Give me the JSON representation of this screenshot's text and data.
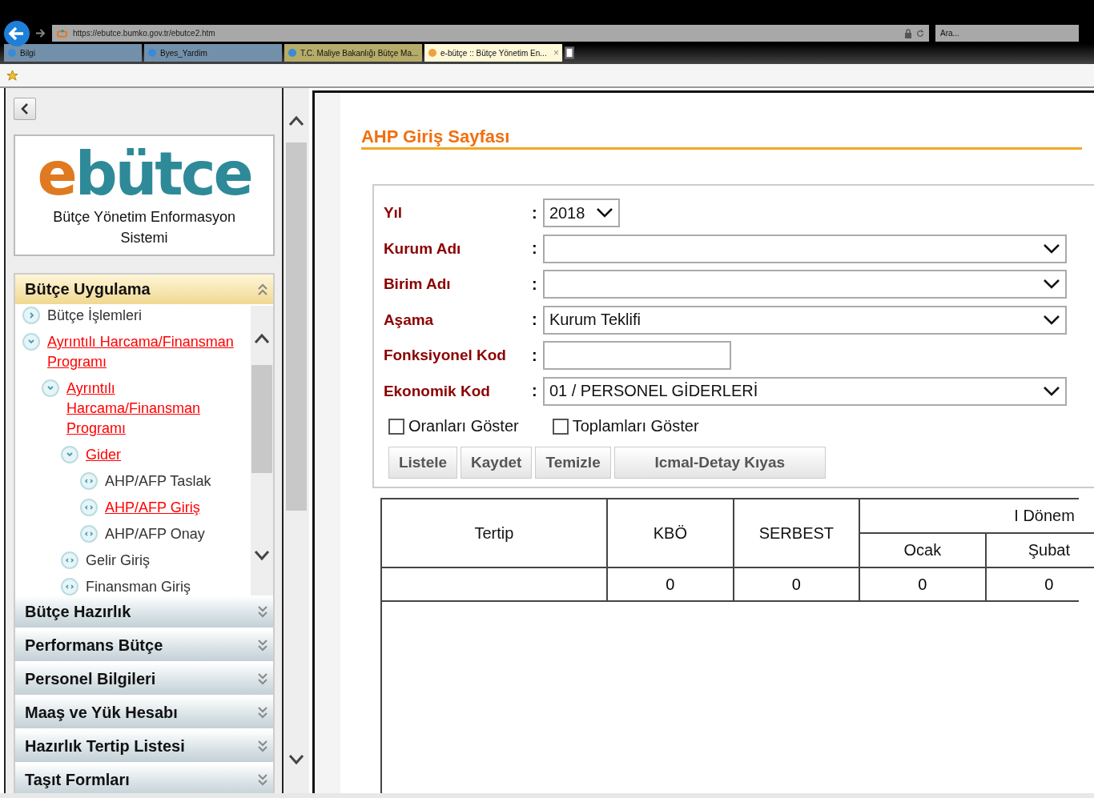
{
  "browser": {
    "address": "https://ebutce.bumko.gov.tr/ebutce2.htm",
    "search": {
      "placeholder": "Ara..."
    },
    "tabs": [
      {
        "label": "Bilgi",
        "selected": false,
        "color": "#7390aa"
      },
      {
        "label": "Byes_Yardim",
        "selected": false,
        "color": "#7390aa"
      },
      {
        "label": "T.C. Maliye Bakanlığı Bütçe Ma...",
        "selected": false,
        "color": "#b5ac6a"
      },
      {
        "label": "e-bütçe :: Bütçe Yönetim En...",
        "selected": true,
        "color": "#fdf8d8",
        "close": "×"
      }
    ]
  },
  "sidebar": {
    "logo": {
      "accent": "e",
      "rest": "bütce"
    },
    "subtitle": "Bütçe Yönetim Enformasyon Sistemi",
    "sections": [
      {
        "title": "Bütçe Uygulama",
        "expanded": true,
        "tree": [
          {
            "label": "Bütçe İşlemleri",
            "kind": "folder",
            "expanded": false,
            "active": false
          },
          {
            "label": "Ayrıntılı Harcama/Finansman Programı",
            "kind": "folder",
            "expanded": true,
            "active": true,
            "children": [
              {
                "label": "Ayrıntılı Harcama/Finansman Programı",
                "kind": "folder",
                "expanded": true,
                "active": true,
                "children": [
                  {
                    "label": "Gider",
                    "kind": "folder",
                    "expanded": true,
                    "active": true,
                    "children": [
                      {
                        "label": "AHP/AFP Taslak",
                        "kind": "leaf",
                        "active": false
                      },
                      {
                        "label": "AHP/AFP Giriş",
                        "kind": "leaf",
                        "active": true
                      },
                      {
                        "label": "AHP/AFP Onay",
                        "kind": "leaf",
                        "active": false
                      }
                    ]
                  },
                  {
                    "label": "Gelir Giriş",
                    "kind": "leaf",
                    "active": false
                  },
                  {
                    "label": "Finansman Giriş",
                    "kind": "leaf",
                    "active": false
                  }
                ]
              }
            ]
          }
        ]
      },
      {
        "title": "Bütçe Hazırlık",
        "expanded": false
      },
      {
        "title": "Performans Bütçe",
        "expanded": false
      },
      {
        "title": "Personel Bilgileri",
        "expanded": false
      },
      {
        "title": "Maaş ve Yük Hesabı",
        "expanded": false
      },
      {
        "title": "Hazırlık Tertip Listesi",
        "expanded": false
      },
      {
        "title": "Taşıt Formları",
        "expanded": false
      }
    ]
  },
  "page": {
    "title": "AHP Giriş Sayfası",
    "fields": [
      {
        "label": "Yıl",
        "separator": ":",
        "kind": "select-short",
        "value": "2018"
      },
      {
        "label": "Kurum Adı",
        "separator": ":",
        "kind": "select"
      },
      {
        "label": "Birim Adı",
        "separator": ":",
        "kind": "select"
      },
      {
        "label": "Aşama",
        "separator": ":",
        "kind": "select",
        "value": "Kurum Teklifi"
      },
      {
        "label": "Fonksiyonel Kod",
        "separator": ":",
        "kind": "text"
      },
      {
        "label": "Ekonomik Kod",
        "separator": ":",
        "kind": "select",
        "value": "01 / PERSONEL GİDERLERİ"
      }
    ],
    "checkboxes": [
      {
        "label": "Oranları Göster",
        "checked": false
      },
      {
        "label": "Toplamları Göster",
        "checked": false
      }
    ],
    "buttons": [
      "Listele",
      "Kaydet",
      "Temizle",
      "Icmal-Detay Kıyas"
    ],
    "table": {
      "columns": [
        {
          "label": "Tertip"
        },
        {
          "label": "KBÖ"
        },
        {
          "label": "SERBEST"
        },
        {
          "label": "I Dönem",
          "children": [
            {
              "label": "Ocak"
            },
            {
              "label": "Şubat"
            }
          ]
        }
      ],
      "rows": [
        {
          "cells": [
            "",
            "0",
            "0",
            "0",
            "0"
          ]
        }
      ]
    }
  }
}
